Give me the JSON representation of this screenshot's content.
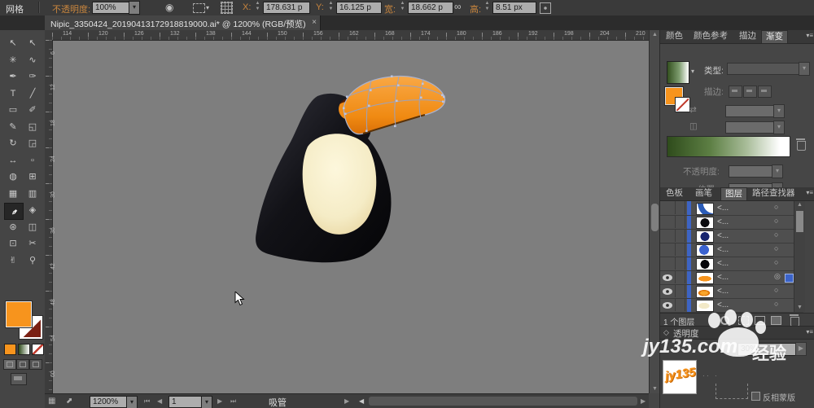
{
  "topbar": {
    "tool": "网格",
    "opacity_label": "不透明度:",
    "opacity_value": "100%",
    "x_label": "X:",
    "x_value": "178.631 p",
    "y_label": "Y:",
    "y_value": "16.125 p",
    "w_label": "宽:",
    "w_value": "18.662 p",
    "h_label": "高:",
    "h_value": "8.51 px"
  },
  "doc_tab": {
    "title": "Nipic_3350424_20190413172918819000.ai* @ 1200% (RGB/预览)",
    "close": "×"
  },
  "toolbar": {
    "tools": [
      {
        "name": "selection-tool",
        "glyph": "↖"
      },
      {
        "name": "direct-selection-tool",
        "glyph": "↖"
      },
      {
        "name": "magic-wand-tool",
        "glyph": "✳"
      },
      {
        "name": "lasso-tool",
        "glyph": "∿"
      },
      {
        "name": "pen-tool",
        "glyph": "✒"
      },
      {
        "name": "anchor-point-tool",
        "glyph": "✑"
      },
      {
        "name": "type-tool",
        "glyph": "T"
      },
      {
        "name": "line-tool",
        "glyph": "╱"
      },
      {
        "name": "rectangle-tool",
        "glyph": "▭"
      },
      {
        "name": "paintbrush-tool",
        "glyph": "✐"
      },
      {
        "name": "pencil-tool",
        "glyph": "✎"
      },
      {
        "name": "eraser-tool",
        "glyph": "◱"
      },
      {
        "name": "rotate-tool",
        "glyph": "↻"
      },
      {
        "name": "scale-tool",
        "glyph": "◲"
      },
      {
        "name": "width-tool",
        "glyph": "↔"
      },
      {
        "name": "free-transform-tool",
        "glyph": "▫"
      },
      {
        "name": "shape-builder-tool",
        "glyph": "◍"
      },
      {
        "name": "perspective-grid-tool",
        "glyph": "⊞"
      },
      {
        "name": "mesh-tool",
        "glyph": "▦"
      },
      {
        "name": "gradient-tool",
        "glyph": "▥"
      },
      {
        "name": "eyedropper-tool",
        "glyph": "✒",
        "rot": true,
        "selected": true
      },
      {
        "name": "blend-tool",
        "glyph": "◈"
      },
      {
        "name": "symbol-sprayer-tool",
        "glyph": "⊛"
      },
      {
        "name": "graph-tool",
        "glyph": "◫"
      },
      {
        "name": "artboard-tool",
        "glyph": "⊡"
      },
      {
        "name": "slice-tool",
        "glyph": "✂"
      },
      {
        "name": "hand-tool",
        "glyph": "✌"
      },
      {
        "name": "zoom-tool",
        "glyph": "⚲"
      }
    ]
  },
  "rulers": {
    "top": [
      "114",
      "120",
      "126",
      "132",
      "138",
      "144",
      "150",
      "156",
      "162",
      "168",
      "174",
      "180",
      "186",
      "192",
      "198",
      "204",
      "210"
    ],
    "left": [
      "6",
      "12",
      "18",
      "24",
      "30",
      "36",
      "42",
      "48",
      "54",
      "60"
    ]
  },
  "panels": {
    "tabs_top": [
      {
        "label": "颜色"
      },
      {
        "label": "颜色参考"
      },
      {
        "label": "描边"
      },
      {
        "label": "渐变",
        "active": true
      }
    ],
    "gradient": {
      "type_label": "类型:",
      "stroke_label": "描边:",
      "opacity_label": "不透明度:",
      "position_label": "位置:"
    },
    "tabs_mid": [
      {
        "label": "色板"
      },
      {
        "label": "画笔"
      },
      {
        "label": "图层",
        "active": true
      },
      {
        "label": "路径查找器"
      }
    ],
    "layers": {
      "rows": [
        {
          "eye": false,
          "thumb": "arc-blue",
          "label": "<...",
          "selected": false
        },
        {
          "eye": false,
          "thumb": "circle-black",
          "label": "<...",
          "selected": false
        },
        {
          "eye": false,
          "thumb": "circle-navy",
          "label": "<...",
          "selected": false
        },
        {
          "eye": false,
          "thumb": "circle-blue",
          "label": "<...",
          "selected": false
        },
        {
          "eye": false,
          "thumb": "circle-black2",
          "label": "<...",
          "selected": false
        },
        {
          "eye": true,
          "thumb": "beak-orange",
          "label": "<...",
          "selected": true
        },
        {
          "eye": true,
          "thumb": "beak-gradient",
          "label": "<...",
          "selected": false
        },
        {
          "eye": true,
          "thumb": "face-cream",
          "label": "<...",
          "selected": false
        }
      ],
      "footer": "1 个图层"
    },
    "transparency": {
      "header": "透明度",
      "opacity_value": "30%",
      "invert_label": "反相蒙版"
    }
  },
  "statusbar": {
    "zoom": "1200%",
    "artboard": "1",
    "tool_name": "吸管"
  },
  "watermark": {
    "site": "jy135.com",
    "brand": "经验",
    "logo": "jy135"
  },
  "colors": {
    "accent_orange": "#f7941d",
    "mesh_line": "#96a3c8",
    "canvas_gray": "#7e7e7e",
    "gradient_start": "#2f4c1c",
    "gradient_end": "#ffffff",
    "layer_select_blue": "#3d64c4"
  }
}
